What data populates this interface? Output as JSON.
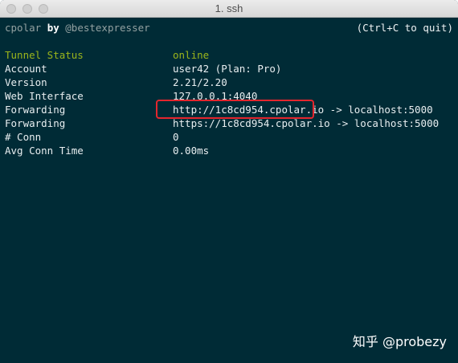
{
  "window": {
    "title": "1. ssh"
  },
  "header": {
    "app_name": "cpolar",
    "by": "by",
    "author": "@bestexpresser",
    "quit_hint": "(Ctrl+C to quit)"
  },
  "status_rows": [
    {
      "label": "Tunnel Status",
      "value": "online"
    },
    {
      "label": "Account",
      "value": "user42 (Plan: Pro)"
    },
    {
      "label": "Version",
      "value": "2.21/2.20"
    },
    {
      "label": "Web Interface",
      "value": "127.0.0.1:4040"
    },
    {
      "label": "Forwarding",
      "value": "http://1c8cd954.cpolar.io",
      "target": " -> localhost:5000"
    },
    {
      "label": "Forwarding",
      "value": "https://1c8cd954.cpolar.io",
      "target": " -> localhost:5000"
    },
    {
      "label": "# Conn",
      "value": "0"
    },
    {
      "label": "Avg Conn Time",
      "value": "0.00ms"
    }
  ],
  "watermark": "知乎 @probezy",
  "colors": {
    "background": "#002b36",
    "status_green": "#9bb51b",
    "highlight_red": "#e3262e"
  }
}
